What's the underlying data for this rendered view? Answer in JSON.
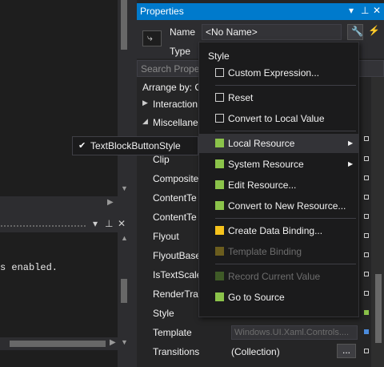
{
  "output": {
    "text": "s enabled."
  },
  "properties": {
    "title": "Properties",
    "name_label": "Name",
    "name_value": "<No Name>",
    "type_label": "Type",
    "search_placeholder": "Search Prope",
    "arrange_label": "Arrange by: C",
    "categories": [
      "Interaction",
      "Miscellane"
    ],
    "rows": [
      {
        "name": "Clip",
        "value": ""
      },
      {
        "name": "Composite",
        "value": ""
      },
      {
        "name": "ContentTe",
        "value": ""
      },
      {
        "name": "ContentTe",
        "value": ""
      },
      {
        "name": "Flyout",
        "value": ""
      },
      {
        "name": "FlyoutBase",
        "value": ""
      },
      {
        "name": "IsTextScale",
        "value": ""
      },
      {
        "name": "RenderTran",
        "value": ""
      },
      {
        "name": "Style",
        "value": ""
      },
      {
        "name": "Template",
        "value": "Windows.UI.Xaml.Controls...."
      },
      {
        "name": "Transitions",
        "value": "(Collection)"
      }
    ],
    "ellipsis_label": "..."
  },
  "submenu": {
    "item": "TextBlockButtonStyle"
  },
  "menu": {
    "header": "Style",
    "items": {
      "custom_expression": "Custom Expression...",
      "reset": "Reset",
      "convert_local": "Convert to Local Value",
      "local_resource": "Local Resource",
      "system_resource": "System Resource",
      "edit_resource": "Edit Resource...",
      "convert_new_resource": "Convert to New Resource...",
      "create_binding": "Create Data Binding...",
      "template_binding": "Template Binding",
      "record_value": "Record Current Value",
      "go_to_source": "Go to Source"
    }
  },
  "colors": {
    "accent": "#007acc",
    "resource_green": "#8bc34a",
    "binding_yellow": "#f6c31c"
  },
  "icons": [
    "shortcut-icon",
    "wrench-icon",
    "lightning-icon",
    "pin-icon",
    "close-icon",
    "checkmark-icon",
    "submenu-arrow-icon"
  ]
}
